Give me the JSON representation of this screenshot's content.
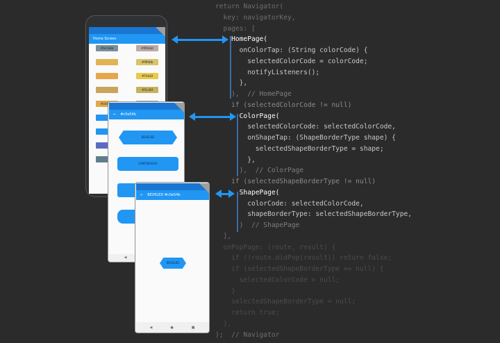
{
  "phones": {
    "home": {
      "title": "Home Screen",
      "chips": [
        "#9e7e8b",
        "#f9564d",
        "",
        "#f9fd0b",
        "",
        "#f7dc6f",
        "",
        "#f1c40f",
        "#c0d136",
        "#39c744",
        "",
        "",
        "",
        "",
        "",
        "",
        ""
      ],
      "chip_colors": [
        "#78909c",
        "#bcaaa4",
        "#e0b455",
        "#d9c36a",
        "#e7a64b",
        "#e8c94c",
        "#c9a55b",
        "#c4b35c",
        "#e0a94a",
        "#9e9e9e",
        "#2196f3",
        "#e7ebef",
        "#2196f3",
        "#e7ebef",
        "#5c6bc0",
        "#e7ebef",
        "#607d8b"
      ]
    },
    "color": {
      "title": "#c0e54b",
      "back_icon": "arrow-left-icon",
      "buttons": [
        "BEVELED",
        "CONTINUOUS",
        "",
        ""
      ]
    },
    "shape": {
      "title": "BEVELED #c0e54b",
      "back_icon": "arrow-left-icon",
      "button": "BEVELED",
      "nav": [
        "◀",
        "●",
        "■"
      ]
    }
  },
  "code": {
    "lines": [
      {
        "text": "return Navigator(",
        "style": "dim"
      },
      {
        "text": "  key: navigatorKey,",
        "style": "dim"
      },
      {
        "text": "  pages: [",
        "style": "dim"
      },
      {
        "text": "    HomePage(",
        "style": "white"
      },
      {
        "text": "      onColorTap: (String colorCode) {",
        "style": "bright"
      },
      {
        "text": "        selectedColorCode = colorCode;",
        "style": "bright"
      },
      {
        "text": "        notifyListeners();",
        "style": "bright"
      },
      {
        "text": "      },",
        "style": "bright"
      },
      {
        "text": "    ),  // HomePage",
        "style": "cmt"
      },
      {
        "text": "    if (selectedColorCode != null)",
        "style": "kw"
      },
      {
        "text": "      ColorPage(",
        "style": "white"
      },
      {
        "text": "        selectedColorCode: selectedColorCode,",
        "style": "bright"
      },
      {
        "text": "        onShapeTap: (ShapeBorderType shape) {",
        "style": "bright"
      },
      {
        "text": "          selectedShapeBorderType = shape;",
        "style": "bright"
      },
      {
        "text": "        },",
        "style": "bright"
      },
      {
        "text": "      ),  // ColorPage",
        "style": "cmt"
      },
      {
        "text": "    if (selectedShapeBorderType != null)",
        "style": "kw"
      },
      {
        "text": "      ShapePage(",
        "style": "white"
      },
      {
        "text": "        colorCode: selectedColorCode,",
        "style": "bright"
      },
      {
        "text": "        shapeBorderType: selectedShapeBorderType,",
        "style": "bright"
      },
      {
        "text": "      )  // ShapePage",
        "style": "cmt"
      },
      {
        "text": "  ],",
        "style": "dim"
      },
      {
        "text": "  onPopPage: (route, result) {",
        "style": "dim2"
      },
      {
        "text": "    if (!route.didPop(result)) return false;",
        "style": "dim2"
      },
      {
        "text": "    if (selectedShapeBorderType == null) {",
        "style": "dim2"
      },
      {
        "text": "      selectedColorCode = null;",
        "style": "dim2"
      },
      {
        "text": "    }",
        "style": "dim2"
      },
      {
        "text": "    selectedShapeBorderType = null;",
        "style": "dim2"
      },
      {
        "text": "    return true;",
        "style": "dim2"
      },
      {
        "text": "  },",
        "style": "dim2"
      },
      {
        "text": ");  // Navigator",
        "style": "dim"
      }
    ]
  },
  "colors": {
    "background": "#2b2b2b",
    "accent": "#2196f3",
    "status_bar": "#1976d2"
  }
}
